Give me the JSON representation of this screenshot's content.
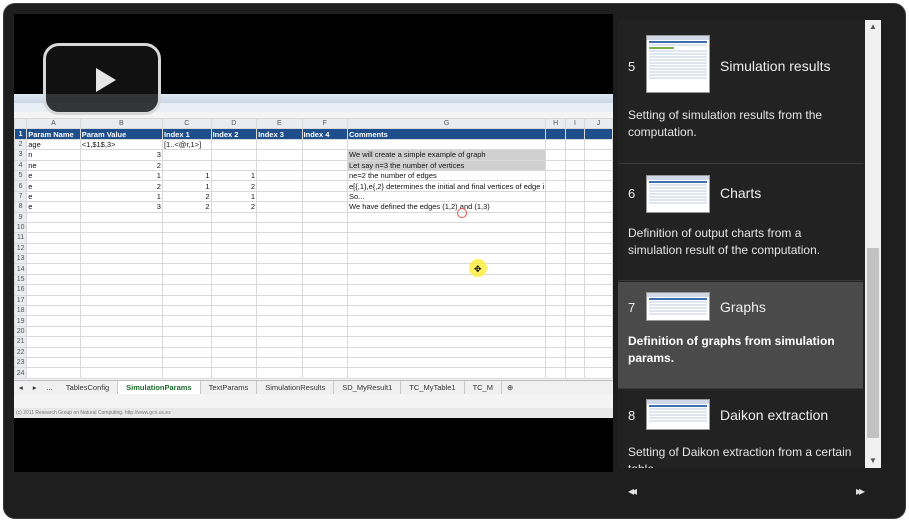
{
  "spreadsheet": {
    "columns": [
      "A",
      "B",
      "C",
      "D",
      "E",
      "F",
      "G",
      "H",
      "I",
      "J"
    ],
    "header_row": [
      "Param Name",
      "Param Value",
      "Index 1",
      "Index 2",
      "Index 3",
      "Index 4",
      "Comments"
    ],
    "rows": [
      [
        "age",
        "<1,$1$,3>",
        "[1..<@r,1>]",
        "",
        "",
        "",
        ""
      ],
      [
        "n",
        "3",
        "",
        "",
        "",
        "",
        "We will create a simple example of graph"
      ],
      [
        "ne",
        "2",
        "",
        "",
        "",
        "",
        "Let say n=3 the number of vertices"
      ],
      [
        "e",
        "1",
        "1",
        "1",
        "",
        "",
        "ne=2 the number of edges"
      ],
      [
        "e",
        "2",
        "1",
        "2",
        "",
        "",
        "e[{,1},e{,2} determines the initial and final vertices of edge i"
      ],
      [
        "e",
        "1",
        "2",
        "1",
        "",
        "",
        "So..."
      ],
      [
        "e",
        "3",
        "2",
        "2",
        "",
        "",
        "We have defined the edges (1,2) and (1,3)"
      ]
    ],
    "row_numbers": [
      "1",
      "2",
      "3",
      "4",
      "5",
      "6",
      "7",
      "8",
      "9",
      "10",
      "11",
      "12",
      "13",
      "14",
      "15",
      "16",
      "17",
      "18",
      "19",
      "20",
      "21",
      "22",
      "23",
      "24"
    ],
    "tabs": [
      "TablesConfig",
      "SimulationParams",
      "TextParams",
      "SimulationResults",
      "SD_MyResult1",
      "TC_MyTable1",
      "TC_M"
    ],
    "active_tab": "SimulationParams",
    "tab_nav": [
      "◂",
      "▸",
      "..."
    ],
    "add_tab": "⊕",
    "status_text": "(c) 2011 Research Group on Natural Computing. http://www.gcn.us.es"
  },
  "playlist": [
    {
      "num": "5",
      "title": "Simulation results",
      "desc": "Setting of simulation results from the computation."
    },
    {
      "num": "6",
      "title": "Charts",
      "desc": "Definition of output charts from a simulation result of the computation."
    },
    {
      "num": "7",
      "title": "Graphs",
      "desc": "Definition of graphs from simulation params."
    },
    {
      "num": "8",
      "title": "Daikon extraction",
      "desc": "Setting of Daikon extraction from a certain table."
    }
  ],
  "active_item": "7",
  "controls": {
    "prev": "◂◂",
    "next": "▸▸",
    "scroll_up": "▲",
    "scroll_down": "▼"
  },
  "colors": {
    "player_bg": "#1e1e1e",
    "active_item_bg": "#4a4a4a",
    "sheet_header_blue": "#1f4e8c"
  }
}
